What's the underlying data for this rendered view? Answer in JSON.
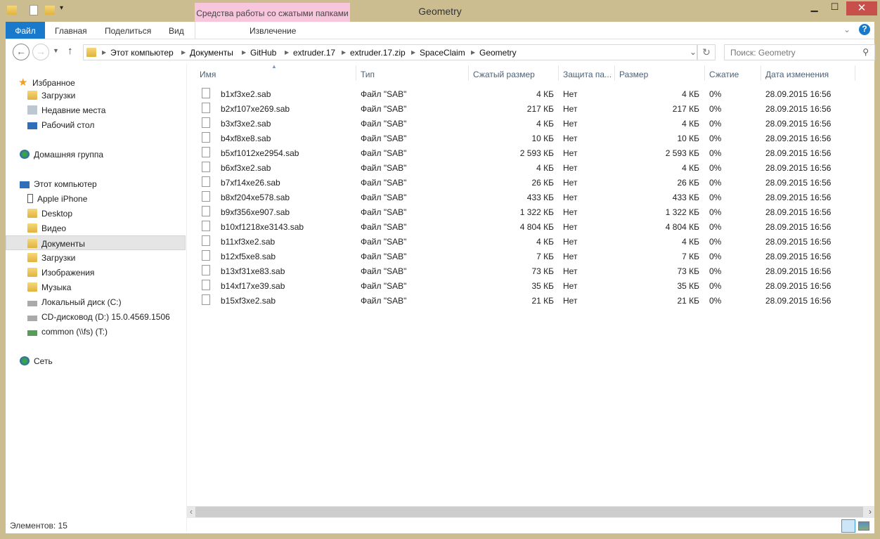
{
  "window": {
    "title": "Geometry",
    "context_tab": "Средства работы со сжатыми папками",
    "minimize": "▁",
    "maximize": "☐",
    "close": "✕"
  },
  "ribbon": {
    "tabs": [
      "Файл",
      "Главная",
      "Поделиться",
      "Вид",
      "Извлечение"
    ],
    "help": "?"
  },
  "address": {
    "crumbs": [
      "Этот компьютер",
      "Документы",
      "GitHub",
      "extruder.17",
      "extruder.17.zip",
      "SpaceClaim",
      "Geometry"
    ],
    "search_placeholder": "Поиск: Geometry"
  },
  "sidebar": {
    "groups": [
      {
        "label": "Избранное",
        "icon": "star-icon",
        "items": [
          "Загрузки",
          "Недавние места",
          "Рабочий стол"
        ]
      },
      {
        "label": "Домашняя группа",
        "icon": "homegroup-icon",
        "items": []
      },
      {
        "label": "Этот компьютер",
        "icon": "computer-icon",
        "items": [
          "Apple iPhone",
          "Desktop",
          "Видео",
          "Документы",
          "Загрузки",
          "Изображения",
          "Музыка",
          "Локальный диск (C:)",
          "CD-дисковод (D:) 15.0.4569.1506",
          "common (\\\\fs) (T:)"
        ]
      },
      {
        "label": "Сеть",
        "icon": "network-icon",
        "items": []
      }
    ],
    "selected": "Документы"
  },
  "columns": [
    "Имя",
    "Тип",
    "Сжатый размер",
    "Защита па...",
    "Размер",
    "Сжатие",
    "Дата изменения"
  ],
  "files": [
    [
      "b1xf3xe2.sab",
      "Файл \"SAB\"",
      "4 КБ",
      "Нет",
      "4 КБ",
      "0%",
      "28.09.2015 16:56"
    ],
    [
      "b2xf107xe269.sab",
      "Файл \"SAB\"",
      "217 КБ",
      "Нет",
      "217 КБ",
      "0%",
      "28.09.2015 16:56"
    ],
    [
      "b3xf3xe2.sab",
      "Файл \"SAB\"",
      "4 КБ",
      "Нет",
      "4 КБ",
      "0%",
      "28.09.2015 16:56"
    ],
    [
      "b4xf8xe8.sab",
      "Файл \"SAB\"",
      "10 КБ",
      "Нет",
      "10 КБ",
      "0%",
      "28.09.2015 16:56"
    ],
    [
      "b5xf1012xe2954.sab",
      "Файл \"SAB\"",
      "2 593 КБ",
      "Нет",
      "2 593 КБ",
      "0%",
      "28.09.2015 16:56"
    ],
    [
      "b6xf3xe2.sab",
      "Файл \"SAB\"",
      "4 КБ",
      "Нет",
      "4 КБ",
      "0%",
      "28.09.2015 16:56"
    ],
    [
      "b7xf14xe26.sab",
      "Файл \"SAB\"",
      "26 КБ",
      "Нет",
      "26 КБ",
      "0%",
      "28.09.2015 16:56"
    ],
    [
      "b8xf204xe578.sab",
      "Файл \"SAB\"",
      "433 КБ",
      "Нет",
      "433 КБ",
      "0%",
      "28.09.2015 16:56"
    ],
    [
      "b9xf356xe907.sab",
      "Файл \"SAB\"",
      "1 322 КБ",
      "Нет",
      "1 322 КБ",
      "0%",
      "28.09.2015 16:56"
    ],
    [
      "b10xf1218xe3143.sab",
      "Файл \"SAB\"",
      "4 804 КБ",
      "Нет",
      "4 804 КБ",
      "0%",
      "28.09.2015 16:56"
    ],
    [
      "b11xf3xe2.sab",
      "Файл \"SAB\"",
      "4 КБ",
      "Нет",
      "4 КБ",
      "0%",
      "28.09.2015 16:56"
    ],
    [
      "b12xf5xe8.sab",
      "Файл \"SAB\"",
      "7 КБ",
      "Нет",
      "7 КБ",
      "0%",
      "28.09.2015 16:56"
    ],
    [
      "b13xf31xe83.sab",
      "Файл \"SAB\"",
      "73 КБ",
      "Нет",
      "73 КБ",
      "0%",
      "28.09.2015 16:56"
    ],
    [
      "b14xf17xe39.sab",
      "Файл \"SAB\"",
      "35 КБ",
      "Нет",
      "35 КБ",
      "0%",
      "28.09.2015 16:56"
    ],
    [
      "b15xf3xe2.sab",
      "Файл \"SAB\"",
      "21 КБ",
      "Нет",
      "21 КБ",
      "0%",
      "28.09.2015 16:56"
    ]
  ],
  "status": {
    "count": "Элементов: 15"
  }
}
